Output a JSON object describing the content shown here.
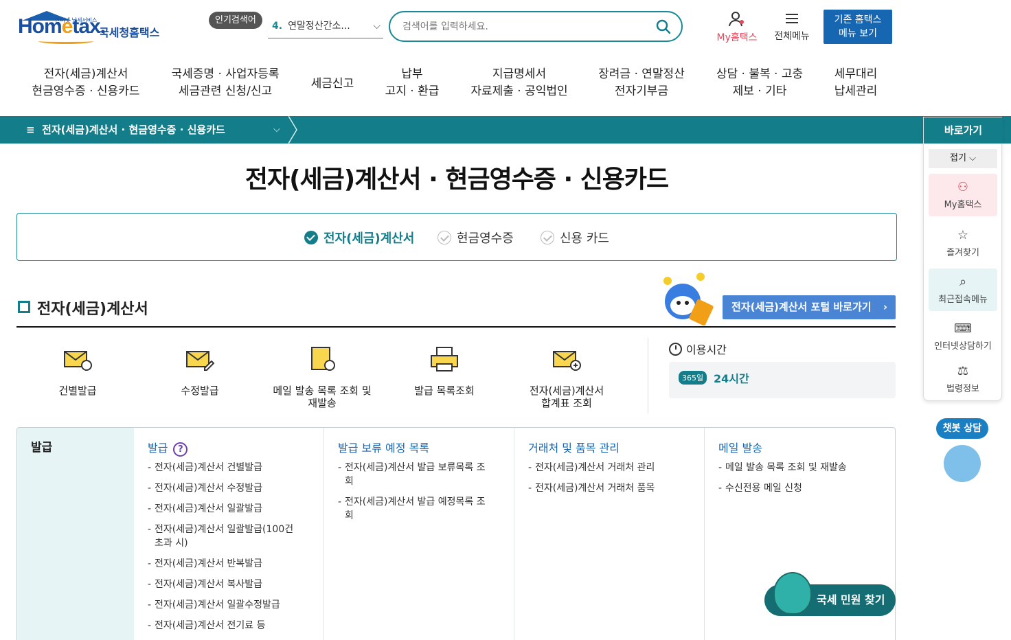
{
  "logo": {
    "small": "안터넷 납세서비스",
    "brand_main": "Hom",
    "brand_e": "e",
    "brand_tail": "tax.",
    "kr": "국세청홈택스"
  },
  "header": {
    "popular_badge": "인기검색어",
    "popular_num": "4.",
    "popular_text": "연말정산간소...",
    "search_placeholder": "검색어를 입력하세요.",
    "my_label": "My홈택스",
    "all_menu_label": "전체메뉴",
    "old_btn_line1": "기존 홈택스",
    "old_btn_line2": "메뉴 보기"
  },
  "gnb": [
    {
      "l1": "전자(세금)계산서",
      "l2": "현금영수증 · 신용카드"
    },
    {
      "l1": "국세증명 · 사업자등록",
      "l2": "세금관련 신청/신고"
    },
    {
      "l1": "세금신고",
      "l2": ""
    },
    {
      "l1": "납부",
      "l2": "고지 · 환급"
    },
    {
      "l1": "지급명세서",
      "l2": "자료제출 · 공익법인"
    },
    {
      "l1": "장려금 · 연말정산",
      "l2": "전자기부금"
    },
    {
      "l1": "상담 · 불복 · 고충",
      "l2": "제보 · 기타"
    },
    {
      "l1": "세무대리",
      "l2": "납세관리"
    }
  ],
  "location": "전자(세금)계산서 · 현금영수증 · 신용카드",
  "page_title": "전자(세금)계산서 · 현금영수증 · 신용카드",
  "tabs": [
    "전자(세금)계산서",
    "현금영수증",
    "신용 카드"
  ],
  "section": {
    "title": "전자(세금)계산서",
    "portal_btn": "전자(세금)계산서 포털 바로가기"
  },
  "quick_items": [
    {
      "line1": "건별발급",
      "line2": ""
    },
    {
      "line1": "수정발급",
      "line2": ""
    },
    {
      "line1": "메일 발송 목록 조회 및",
      "line2": "재발송"
    },
    {
      "line1": "발급 목록조회",
      "line2": ""
    },
    {
      "line1": "전자(세금)계산서",
      "line2": "합계표 조회"
    }
  ],
  "usage": {
    "title": "이용시간",
    "badge": "365일",
    "value": "24시간"
  },
  "table": {
    "head": "발급",
    "cols": [
      {
        "title": "발급",
        "help": "?",
        "items": [
          "전자(세금)계산서 건별발급",
          "전자(세금)계산서 수정발급",
          "전자(세금)계산서 일괄발급",
          "전자(세금)계산서 일괄발급(100건 초과 시)",
          "전자(세금)계산서 반복발급",
          "전자(세금)계산서 복사발급",
          "전자(세금)계산서 일괄수정발급",
          "전자(세금)계산서 전기료 등"
        ]
      },
      {
        "title": "발급 보류 예정 목록",
        "items": [
          "전자(세금)계산서 발급 보류목록 조회",
          "전자(세금)계산서 발급 예정목록 조회"
        ]
      },
      {
        "title": "거래처 및 품목 관리",
        "items": [
          "전자(세금)계산서 거래처 관리",
          "전자(세금)계산서 거래처 품목"
        ]
      },
      {
        "title": "메일 발송",
        "items": [
          "메일 발송 목록 조회 및 재발송",
          "수신전용 메일 신청"
        ]
      }
    ]
  },
  "quickbar": {
    "header": "바로가기",
    "fold": "접기 ⌵",
    "items": [
      "My홈택스",
      "즐겨찾기",
      "최근접속메뉴",
      "인터넷상담하기",
      "법령정보"
    ]
  },
  "chatbot": "챗봇 상담",
  "civil_btn": "국세 민원 찾기",
  "colors": {
    "teal": "#147d8a",
    "blue": "#1766b1",
    "portal": "#4a84d4",
    "pink": "#e8465a"
  }
}
